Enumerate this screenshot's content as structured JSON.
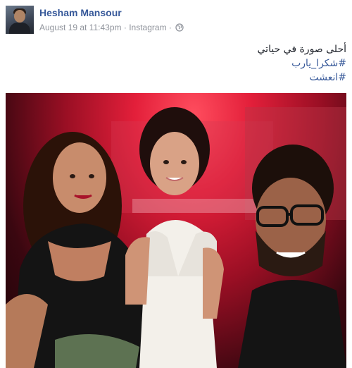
{
  "post": {
    "author": "Hesham Mansour",
    "date": "August 19 at 11:43pm",
    "separator": "·",
    "source": "Instagram",
    "privacy_icon": "globe-icon",
    "text_line": "أحلى صورة في حياتي",
    "hashtags": [
      "#شكرا_يارب",
      "#انعشت"
    ]
  },
  "colors": {
    "link": "#365899",
    "meta": "#90949c",
    "text": "#1d2129"
  }
}
